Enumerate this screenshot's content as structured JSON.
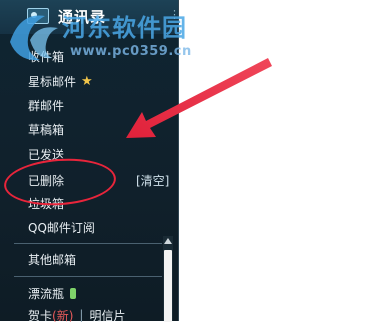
{
  "watermark": {
    "site_name": "河东软件园",
    "url": "www.pc0359.cn"
  },
  "header": {
    "contacts_label": "通讯录"
  },
  "folders": {
    "inbox": "收件箱",
    "starred": "星标邮件",
    "group_mail": "群邮件",
    "drafts": "草稿箱",
    "sent": "已发送",
    "deleted": "已删除",
    "clear": "[清空]",
    "spam": "垃圾箱",
    "qq_subscription": "QQ邮件订阅",
    "other_mailboxes": "其他邮箱",
    "drift_bottle": "漂流瓶",
    "greeting_card": "贺卡",
    "new_tag": "(新)",
    "separator": "|",
    "postcard": "明信片"
  },
  "colors": {
    "sidebar_bg": "#10202b",
    "annotation_red": "#e8253b",
    "star_gold": "#f2c64a"
  }
}
